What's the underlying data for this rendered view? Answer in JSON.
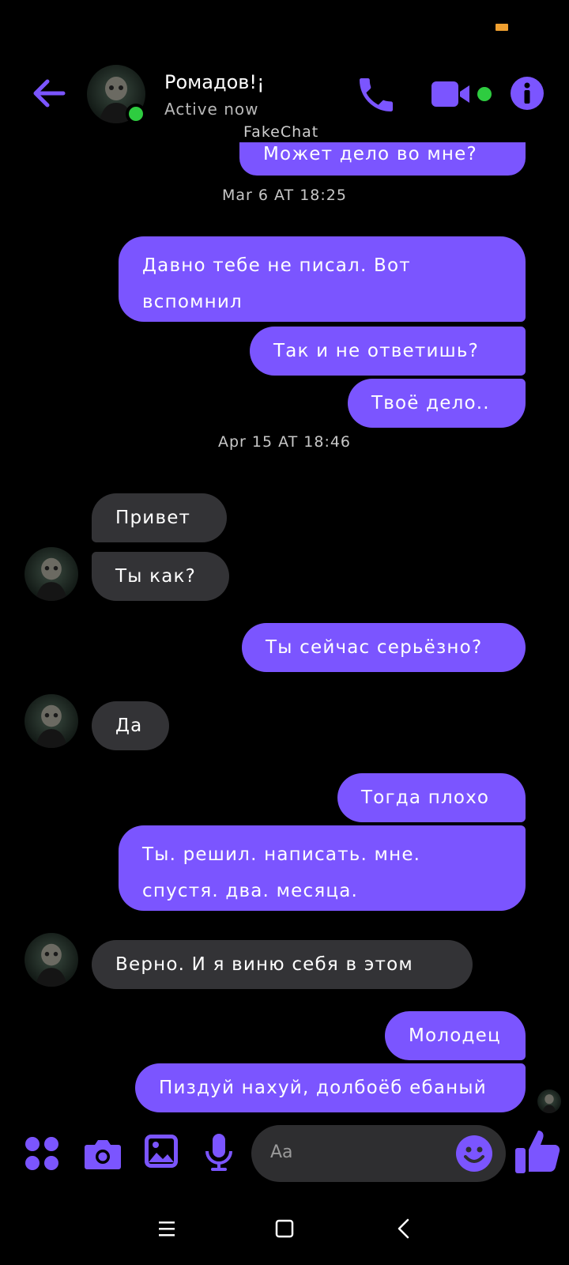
{
  "header": {
    "contact_name": "Ромадов!¡",
    "status": "Active now",
    "watermark": "FakeChat"
  },
  "colors": {
    "accent": "#7b55ff",
    "incoming_bubble": "#333336",
    "online": "#2ecc40",
    "background": "#000000"
  },
  "messages": {
    "m0": "Может дело во мне?",
    "ts1": "Mar 6 AT 18:25",
    "m1_line1": "Давно тебе не писал. Вот",
    "m1_line2": "вспомнил",
    "m2": "Так и не ответишь?",
    "m3": "Твоё дело..",
    "ts2": "Apr 15 AT 18:46",
    "m4": "Привет",
    "m5": "Ты как?",
    "m6": "Ты сейчас серьёзно?",
    "m7": "Да",
    "m8": "Тогда плохо",
    "m9_line1": "Ты. решил. написать. мне.",
    "m9_line2": "спустя. два. месяца.",
    "m10": "Верно. И я виню себя в этом",
    "m11": "Молодец",
    "m12": "Пиздуй нахуй, долбоёб ебаный"
  },
  "composer": {
    "placeholder": "Aa",
    "icons": [
      "apps-icon",
      "camera-icon",
      "image-icon",
      "microphone-icon",
      "emoji-icon",
      "thumbs-up-icon"
    ]
  },
  "navbar": {
    "icons": [
      "menu-icon",
      "home-icon",
      "back-icon"
    ]
  }
}
